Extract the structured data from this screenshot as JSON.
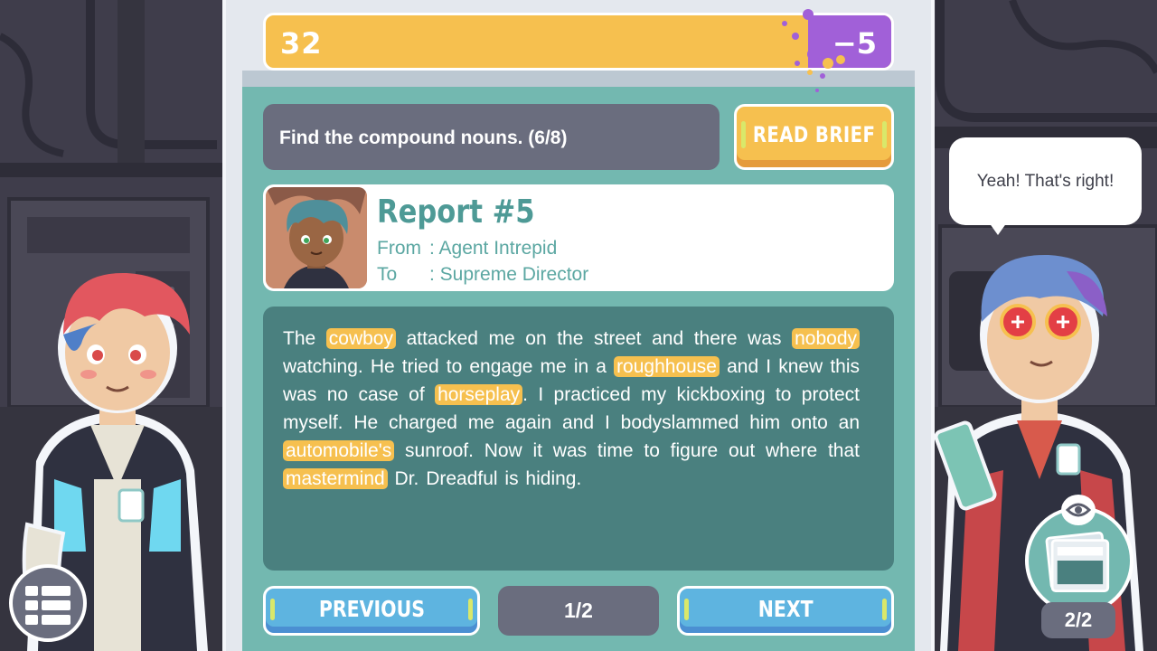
{
  "hud": {
    "score": "32",
    "penalty": "−5"
  },
  "task": {
    "instruction": "Find the compound nouns. (6/8)",
    "read_brief_label": "READ BRIEF"
  },
  "report": {
    "title": "Report #5",
    "from_label": "From",
    "from_value": ": Agent Intrepid",
    "to_label": "To",
    "to_value": ": Supreme Director",
    "body": [
      {
        "t": "The ",
        "h": false
      },
      {
        "t": "cowboy",
        "h": true
      },
      {
        "t": " attacked me on the street and there was ",
        "h": false
      },
      {
        "t": "nobody",
        "h": true
      },
      {
        "t": " watching. He tried to engage me in a ",
        "h": false
      },
      {
        "t": "roughhouse",
        "h": true
      },
      {
        "t": " and I knew this was no case of ",
        "h": false
      },
      {
        "t": "horseplay",
        "h": true
      },
      {
        "t": ". I practiced my kickboxing to protect myself. He charged me again and I bodyslammed him onto an ",
        "h": false
      },
      {
        "t": "automobile's",
        "h": true
      },
      {
        "t": " sunroof. Now it was time to figure out where that ",
        "h": false
      },
      {
        "t": "mastermind",
        "h": true
      },
      {
        "t": " Dr. Dreadful is hiding.",
        "h": false
      }
    ]
  },
  "nav": {
    "previous_label": "PREVIOUS",
    "page_indicator": "1/2",
    "next_label": "NEXT"
  },
  "character_right": {
    "speech": "Yeah! That's right!"
  },
  "evidence": {
    "count": "2/2"
  },
  "colors": {
    "score_bar": "#f6c04f",
    "penalty": "#a160d8",
    "board": "#73b8b0",
    "text_panel": "#4a807f",
    "highlight": "#f6c04f",
    "nav_button": "#5eb4e0"
  },
  "icons": {
    "menu": "menu-icon",
    "evidence_eye": "eye-icon",
    "evidence_doc": "document-icon"
  }
}
